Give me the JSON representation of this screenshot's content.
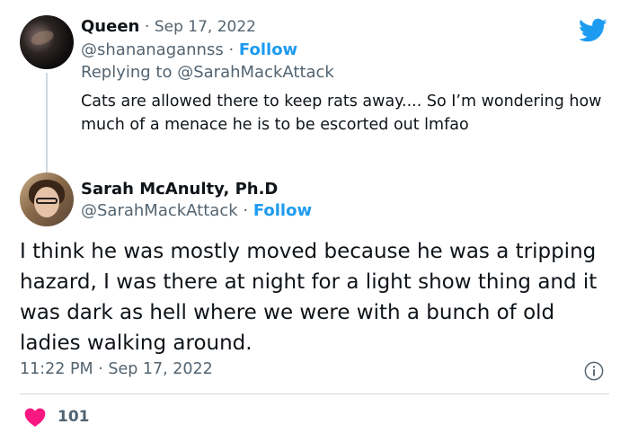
{
  "reply_tweet": {
    "name": "Queen",
    "date": "Sep 17, 2022",
    "handle": "@shananagannss",
    "follow_label": "Follow",
    "replying_prefix": "Replying to",
    "replying_to": "@SarahMackAttack",
    "text": "Cats are allowed there to keep rats away.... So I’m wondering how much of a menace he is to be escorted out lmfao"
  },
  "main_tweet": {
    "name": "Sarah McAnulty, Ph.D",
    "handle": "@SarahMackAttack",
    "follow_label": "Follow",
    "text": "I think he was mostly moved because he was a tripping hazard, I was there at night for a light show thing and it was dark as hell where we were with a bunch of old ladies walking around.",
    "time": "11:22 PM · Sep 17, 2022",
    "like_count": "101"
  },
  "icons": {
    "brand": "twitter-bird-icon",
    "info": "info-icon",
    "like": "heart-icon"
  },
  "colors": {
    "accent": "#1d9bf0",
    "like": "#f91880",
    "secondary_text": "#536471"
  }
}
